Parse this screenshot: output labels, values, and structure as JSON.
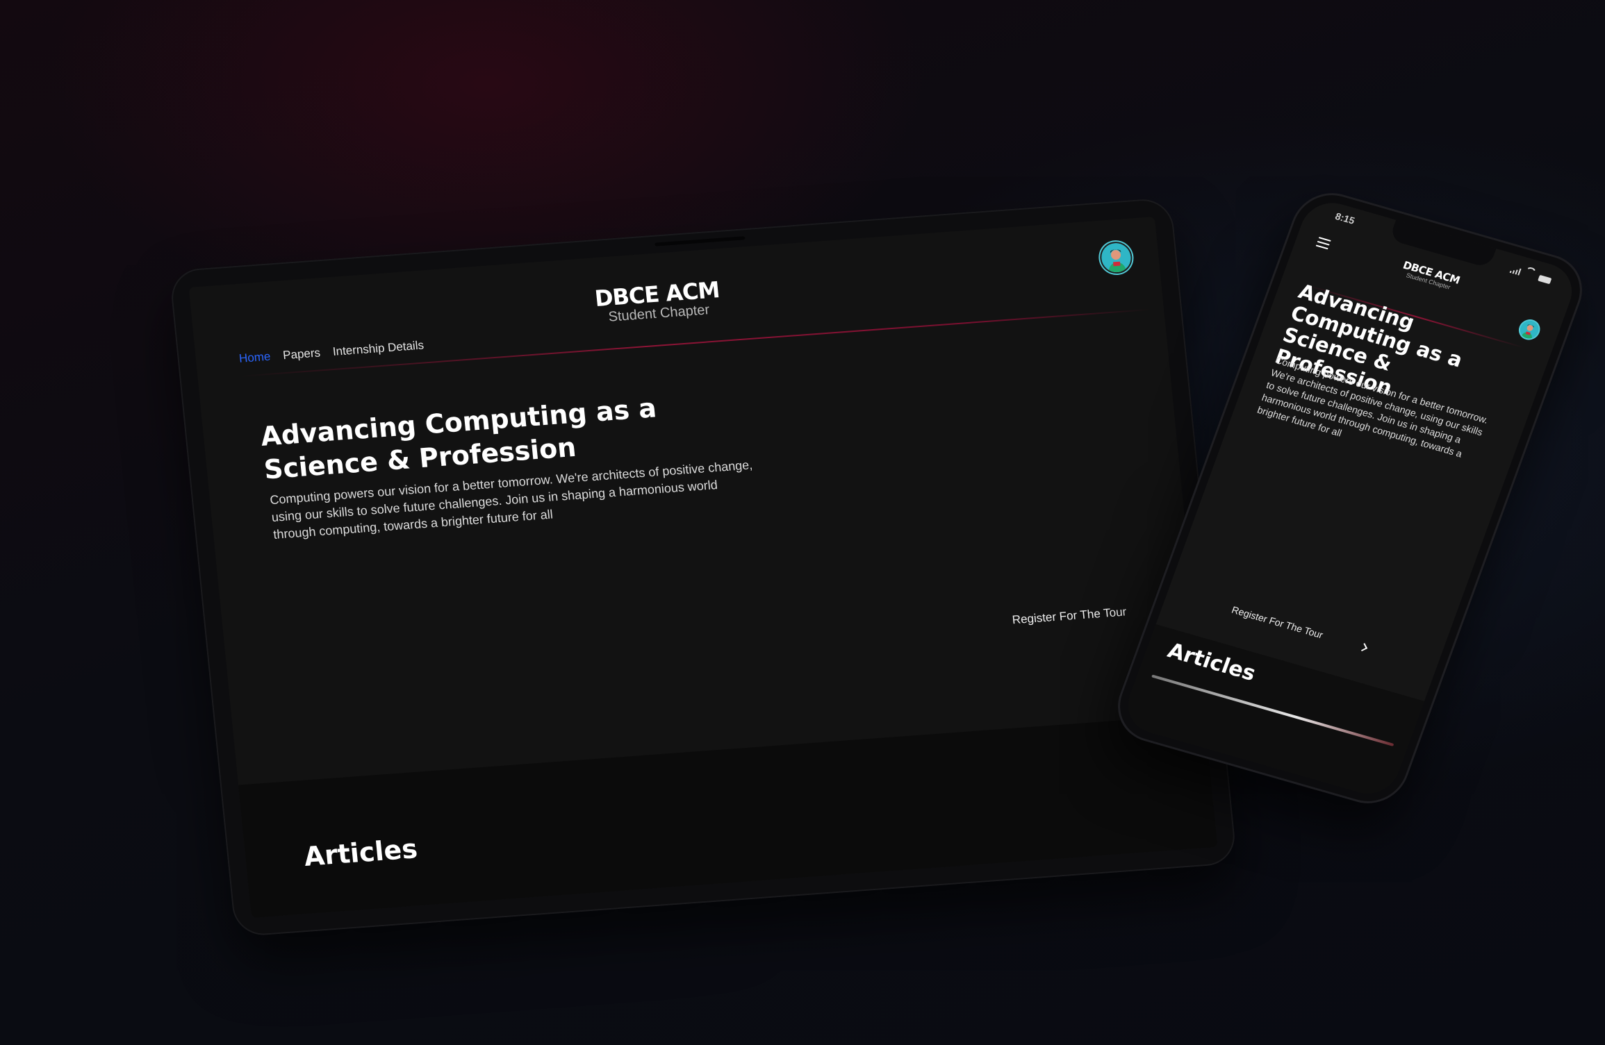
{
  "brand": {
    "title": "DBCE ACM",
    "subtitle": "Student Chapter"
  },
  "nav": {
    "items": [
      {
        "label": "Home",
        "active": true
      },
      {
        "label": "Papers",
        "active": false
      },
      {
        "label": "Internship Details",
        "active": false
      }
    ]
  },
  "hero": {
    "title": "Advancing Computing as a Science & Profession",
    "description": "Computing powers our vision for a better tomorrow. We're architects of positive change, using our skills to solve future challenges. Join us in shaping a harmonious world through computing, towards a brighter future for all"
  },
  "cta": {
    "label": "Register For The Tour",
    "icon": "chevron-right-icon"
  },
  "articles": {
    "heading": "Articles"
  },
  "phone": {
    "status_time": "8:15",
    "menu_icon": "hamburger-menu-icon"
  },
  "colors": {
    "accent_link": "#2b66ff",
    "divider": "#8e1436",
    "screen_bg": "#121212",
    "avatar_bg": "#2fb6c6"
  }
}
